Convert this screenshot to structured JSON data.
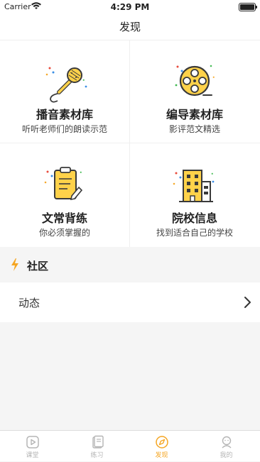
{
  "status_bar": {
    "carrier": "Carrier",
    "time": "4:29 PM"
  },
  "nav": {
    "title": "发现"
  },
  "cards": [
    {
      "title": "播音素材库",
      "subtitle": "听听老师们的朗读示范",
      "icon": "microphone-icon"
    },
    {
      "title": "编导素材库",
      "subtitle": "影评范文精选",
      "icon": "film-reel-icon"
    },
    {
      "title": "文常背练",
      "subtitle": "你必须掌握的",
      "icon": "clipboard-icon"
    },
    {
      "title": "院校信息",
      "subtitle": "找到适合自己的学校",
      "icon": "building-icon"
    }
  ],
  "section": {
    "title": "社区"
  },
  "community_row": {
    "label": "动态"
  },
  "tabs": [
    {
      "label": "课堂",
      "icon": "play-square-icon",
      "active": false
    },
    {
      "label": "练习",
      "icon": "notebook-icon",
      "active": false
    },
    {
      "label": "发现",
      "icon": "compass-icon",
      "active": true
    },
    {
      "label": "我的",
      "icon": "person-icon",
      "active": false
    }
  ],
  "colors": {
    "accent": "#f5a623",
    "icon_fill": "#ffd24a",
    "icon_outline": "#3a3a3a",
    "inactive": "#b5b5b5"
  }
}
